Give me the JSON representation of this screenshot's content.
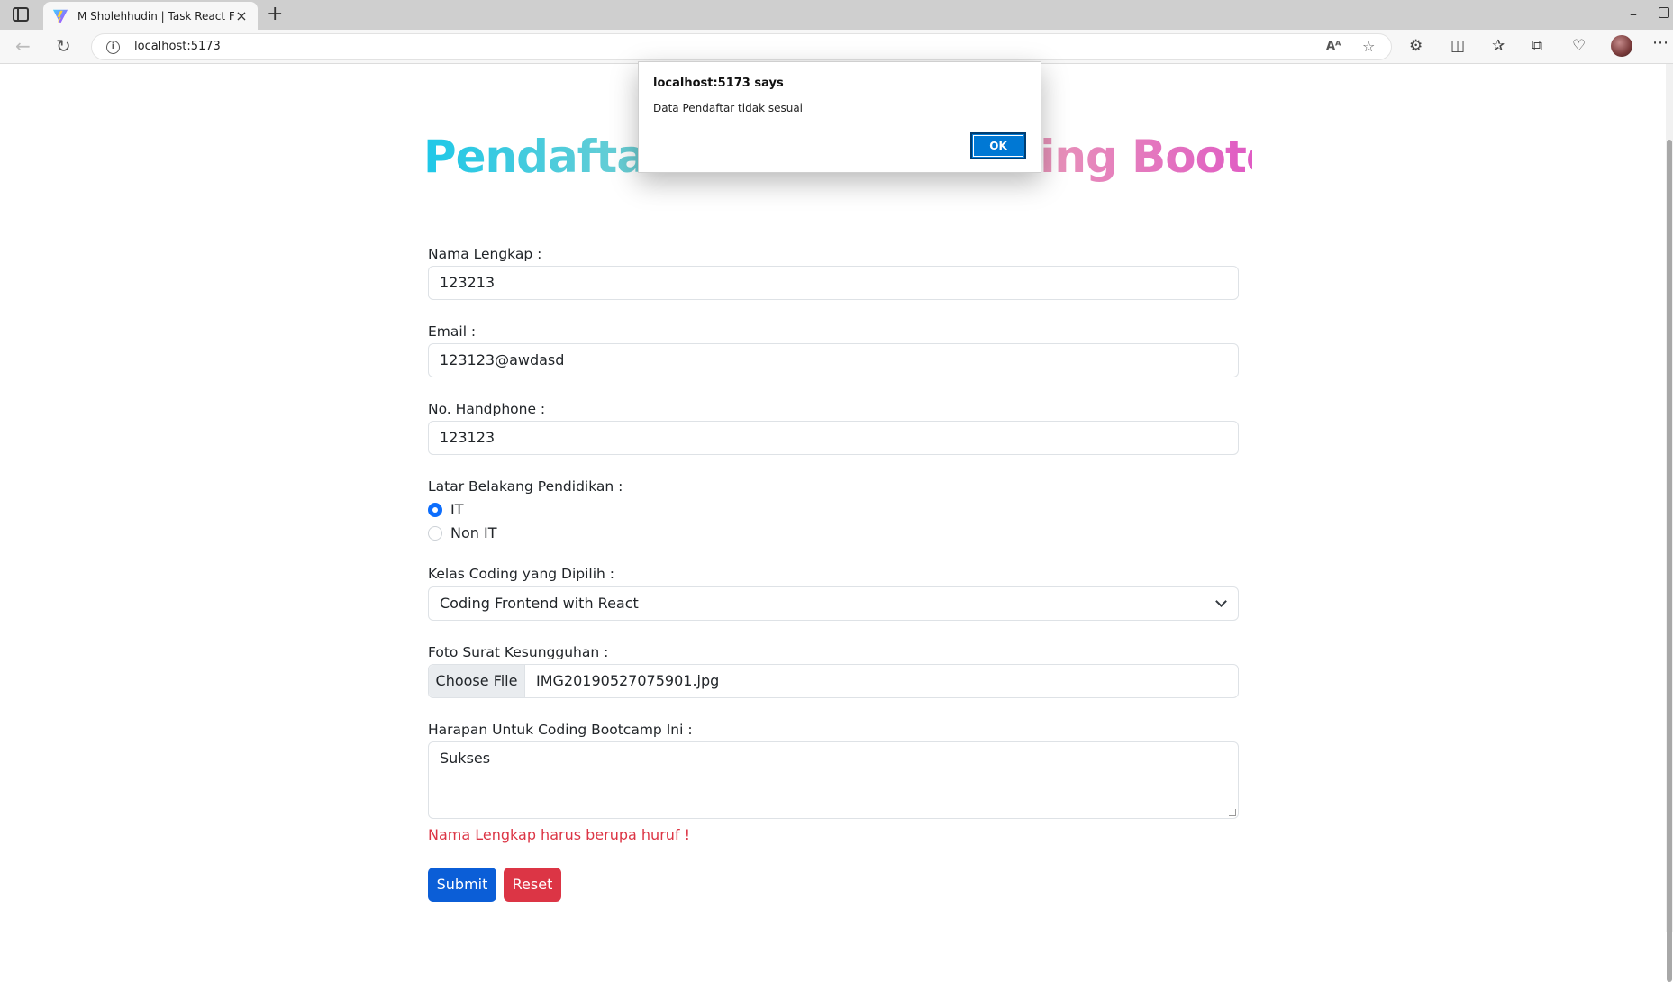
{
  "browser": {
    "tab_title": "M Sholehhudin | Task React Form",
    "url": "localhost:5173",
    "new_tab": "+",
    "close_tab": "×",
    "minimize": "–",
    "more": "⋯"
  },
  "page": {
    "title": "Pendaftaran Peserta Coding Bootcamp",
    "title_gradient": [
      "#1ec8e8",
      "#79cfd0",
      "#c8c09e",
      "#e893b9",
      "#e05cc4"
    ]
  },
  "form": {
    "nama_label": "Nama Lengkap :",
    "nama_value": "123213",
    "email_label": "Email :",
    "email_value": "123123@awdasd",
    "hp_label": "No. Handphone :",
    "hp_value": "123123",
    "pendidikan_label": "Latar Belakang Pendidikan :",
    "pendidikan_options": [
      {
        "label": "IT",
        "checked": true
      },
      {
        "label": "Non IT",
        "checked": false
      }
    ],
    "kelas_label": "Kelas Coding yang Dipilih :",
    "kelas_selected": "Coding Frontend with React",
    "foto_label": "Foto Surat Kesungguhan :",
    "foto_button": "Choose File",
    "foto_filename": "IMG20190527075901.jpg",
    "harapan_label": "Harapan Untuk Coding Bootcamp Ini :",
    "harapan_value": "Sukses",
    "error_message": "Nama Lengkap harus berupa huruf !",
    "submit_label": "Submit",
    "reset_label": "Reset"
  },
  "dialog": {
    "title": "localhost:5173 says",
    "message": "Data Pendaftar tidak sesuai",
    "ok_label": "OK"
  },
  "colors": {
    "primary": "#0b5ed7",
    "danger": "#dc3545",
    "dialog_ok": "#0078d4"
  }
}
